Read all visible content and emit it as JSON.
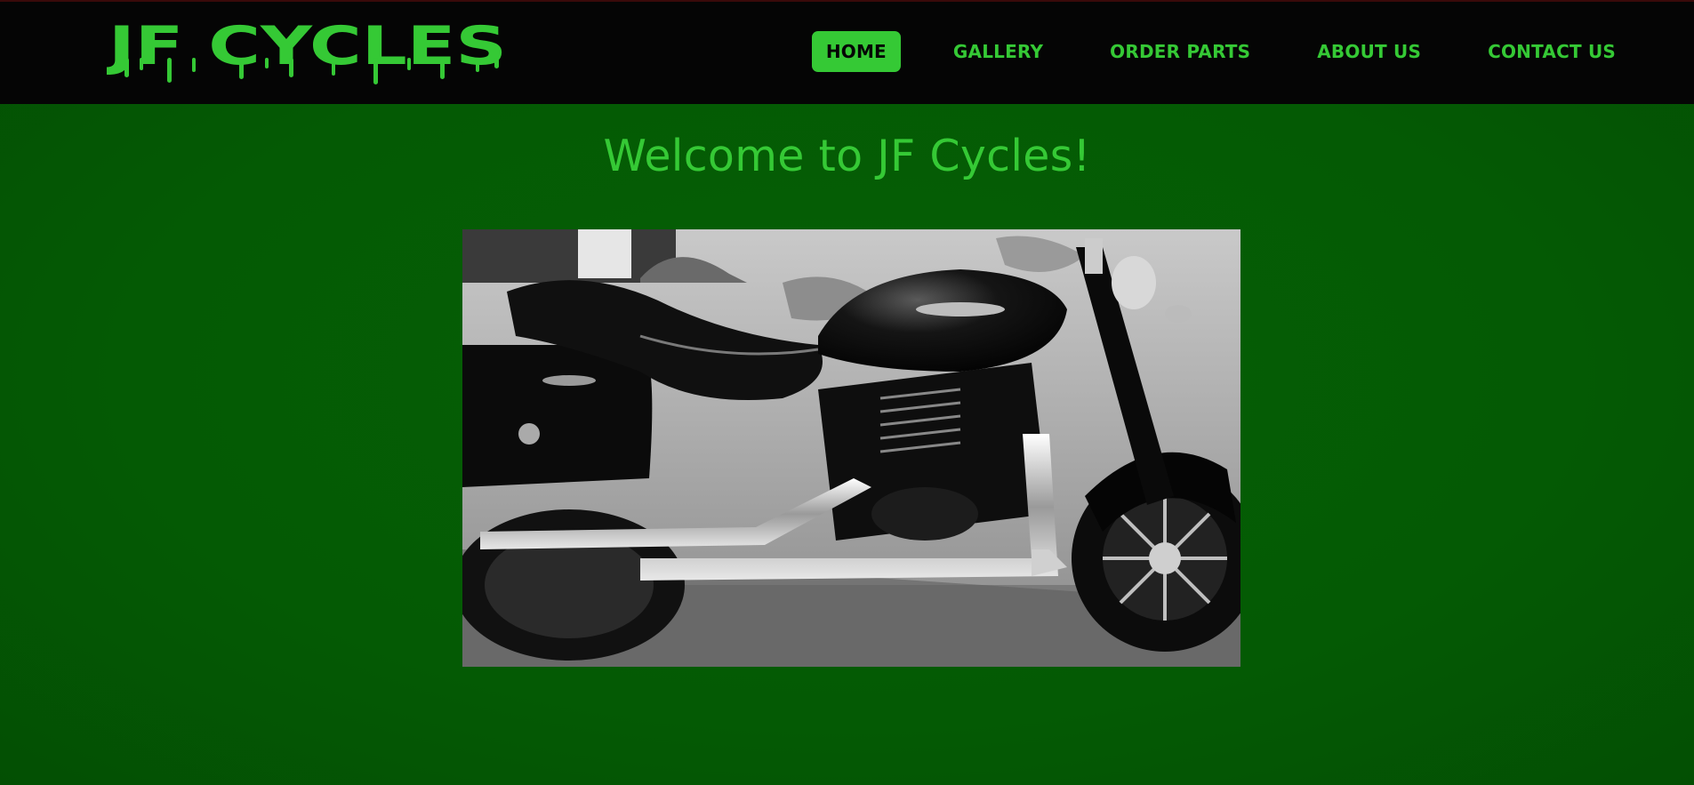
{
  "header": {
    "logo_text": "JF CYCLES",
    "nav": [
      {
        "label": "HOME",
        "active": true
      },
      {
        "label": "GALLERY",
        "active": false
      },
      {
        "label": "ORDER PARTS",
        "active": false
      },
      {
        "label": "ABOUT US",
        "active": false
      },
      {
        "label": "CONTACT US",
        "active": false
      }
    ]
  },
  "main": {
    "heading": "Welcome to JF Cycles!",
    "hero_image": "black-and-white-motorcycle-photo"
  },
  "colors": {
    "accent": "#35c935",
    "header_bg": "#050505",
    "page_bg": "#045c04"
  }
}
